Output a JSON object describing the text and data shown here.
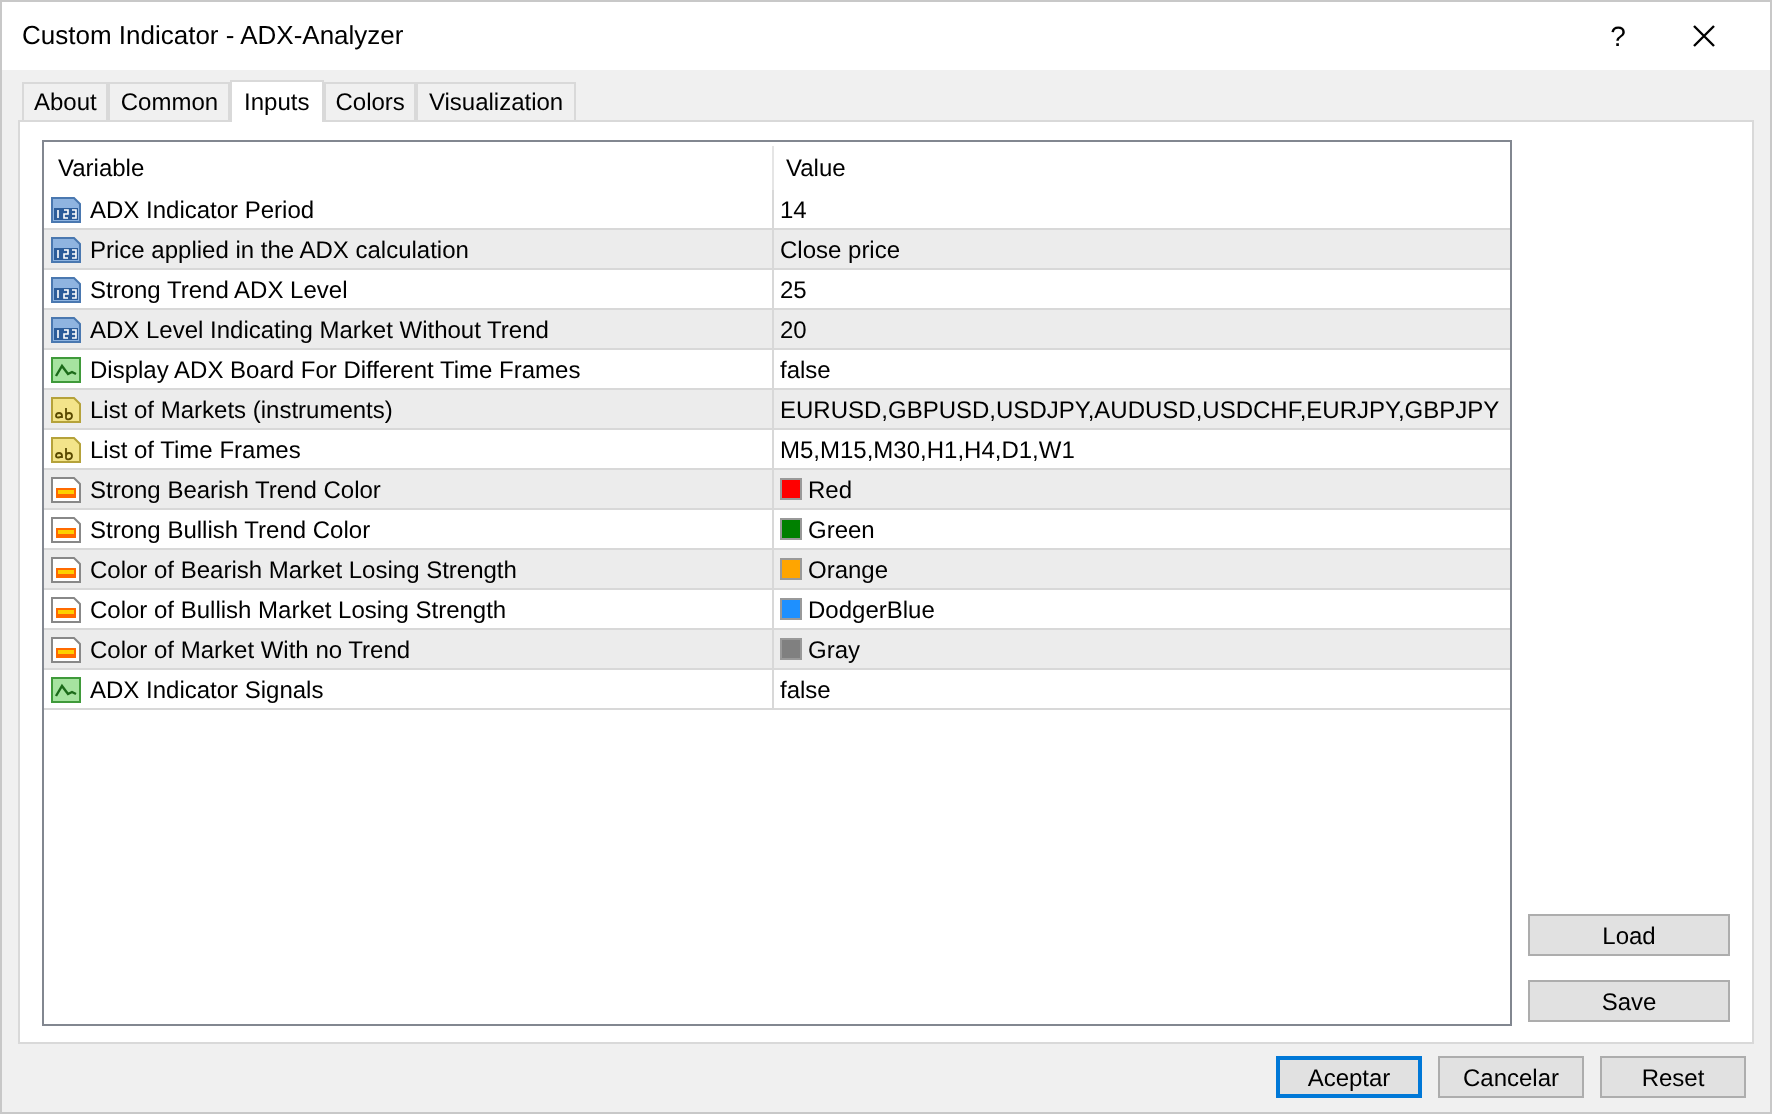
{
  "window": {
    "title": "Custom Indicator - ADX-Analyzer",
    "help": "?"
  },
  "tabs": [
    {
      "label": "About",
      "selected": false
    },
    {
      "label": "Common",
      "selected": false
    },
    {
      "label": "Inputs",
      "selected": true
    },
    {
      "label": "Colors",
      "selected": false
    },
    {
      "label": "Visualization",
      "selected": false
    }
  ],
  "table": {
    "columns": [
      "Variable",
      "Value"
    ],
    "rows": [
      {
        "kind": "number",
        "variable": "ADX Indicator Period",
        "value": "14"
      },
      {
        "kind": "number",
        "variable": "Price applied in the ADX calculation",
        "value": "Close price"
      },
      {
        "kind": "number",
        "variable": "Strong Trend ADX Level",
        "value": "25"
      },
      {
        "kind": "number",
        "variable": "ADX Level Indicating Market Without Trend",
        "value": "20"
      },
      {
        "kind": "bool",
        "variable": "Display ADX Board For Different Time Frames",
        "value": "false"
      },
      {
        "kind": "text",
        "variable": "List of Markets (instruments)",
        "value": "EURUSD,GBPUSD,USDJPY,AUDUSD,USDCHF,EURJPY,GBPJPY"
      },
      {
        "kind": "text",
        "variable": "List of Time Frames",
        "value": "M5,M15,M30,H1,H4,D1,W1"
      },
      {
        "kind": "color",
        "variable": "Strong Bearish Trend Color",
        "value": "Red",
        "color": "#ff0000"
      },
      {
        "kind": "color",
        "variable": "Strong Bullish Trend Color",
        "value": "Green",
        "color": "#008000"
      },
      {
        "kind": "color",
        "variable": "Color of Bearish Market Losing Strength",
        "value": "Orange",
        "color": "#ffa500"
      },
      {
        "kind": "color",
        "variable": "Color of Bullish Market Losing Strength",
        "value": "DodgerBlue",
        "color": "#1e90ff"
      },
      {
        "kind": "color",
        "variable": "Color of Market With no Trend",
        "value": "Gray",
        "color": "#808080"
      },
      {
        "kind": "bool",
        "variable": "ADX Indicator Signals",
        "value": "false"
      }
    ]
  },
  "side_buttons": [
    "Load",
    "Save"
  ],
  "buttons": [
    {
      "label": "Aceptar",
      "default": true
    },
    {
      "label": "Cancelar",
      "default": false
    },
    {
      "label": "Reset",
      "default": false
    }
  ]
}
